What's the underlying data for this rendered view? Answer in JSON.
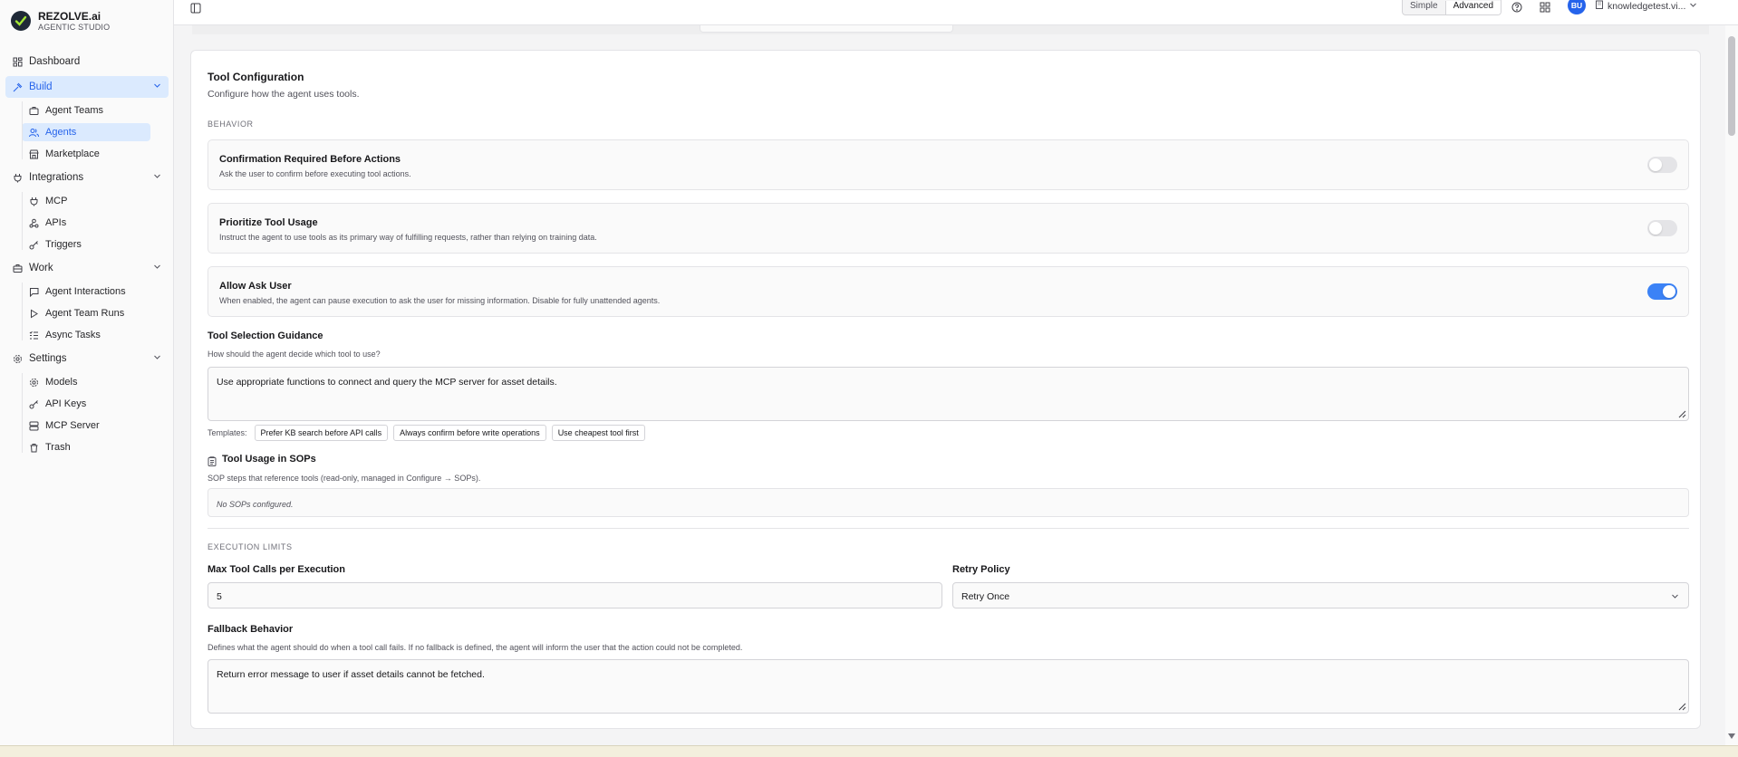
{
  "brand": {
    "name": "REZOLVE.ai",
    "subtitle": "AGENTIC STUDIO"
  },
  "nav": {
    "dashboard": "Dashboard",
    "build": "Build",
    "agent_teams": "Agent Teams",
    "agents": "Agents",
    "marketplace": "Marketplace",
    "integrations": "Integrations",
    "mcp": "MCP",
    "apis": "APIs",
    "triggers": "Triggers",
    "work": "Work",
    "agent_interactions": "Agent Interactions",
    "agent_team_runs": "Agent Team Runs",
    "async_tasks": "Async Tasks",
    "settings": "Settings",
    "models": "Models",
    "api_keys": "API Keys",
    "mcp_server": "MCP Server",
    "trash": "Trash"
  },
  "topbar": {
    "mode_simple": "Simple",
    "mode_advanced": "Advanced",
    "avatar": "BU",
    "tenant": "knowledgetest.vi..."
  },
  "tool_config": {
    "title": "Tool Configuration",
    "description": "Configure how the agent uses tools.",
    "behavior_heading": "BEHAVIOR",
    "options": [
      {
        "title": "Confirmation Required Before Actions",
        "desc": "Ask the user to confirm before executing tool actions.",
        "enabled": false
      },
      {
        "title": "Prioritize Tool Usage",
        "desc": "Instruct the agent to use tools as its primary way of fulfilling requests, rather than relying on training data.",
        "enabled": false
      },
      {
        "title": "Allow Ask User",
        "desc": "When enabled, the agent can pause execution to ask the user for missing information. Disable for fully unattended agents.",
        "enabled": true
      }
    ],
    "guidance_label": "Tool Selection Guidance",
    "guidance_hint": "How should the agent decide which tool to use?",
    "guidance_value": "Use appropriate functions to connect and query the MCP server for asset details.",
    "templates_label": "Templates:",
    "templates": [
      "Prefer KB search before API calls",
      "Always confirm before write operations",
      "Use cheapest tool first"
    ],
    "sop_label": "Tool Usage in SOPs",
    "sop_hint": "SOP steps that reference tools (read-only, managed in Configure → SOPs).",
    "sop_empty": "No SOPs configured.",
    "limits_heading": "EXECUTION LIMITS",
    "max_calls_label": "Max Tool Calls per Execution",
    "max_calls_value": "5",
    "retry_label": "Retry Policy",
    "retry_value": "Retry Once",
    "fallback_label": "Fallback Behavior",
    "fallback_hint": "Defines what the agent should do when a tool call fails. If no fallback is defined, the agent will inform the user that the action could not be completed.",
    "fallback_value": "Return error message to user if asset details cannot be fetched."
  },
  "colors": {
    "accent": "#2563eb",
    "switch_on": "#3b82f6",
    "active_nav_bg": "#dbeafe"
  }
}
